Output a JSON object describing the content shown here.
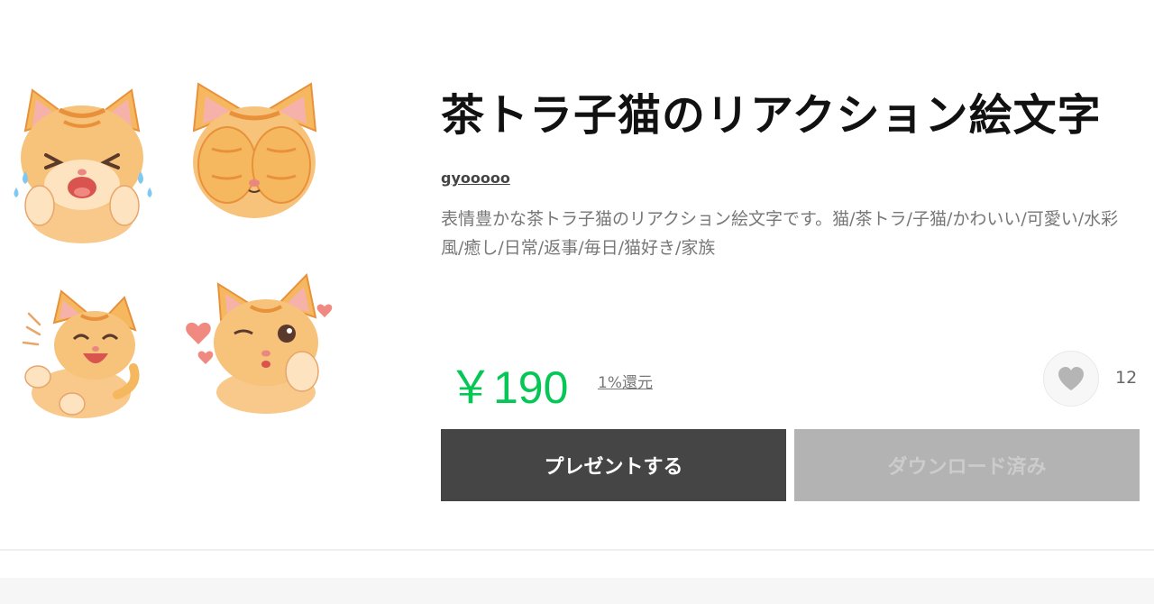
{
  "product": {
    "title": "茶トラ子猫のリアクション絵文字",
    "author": "gyooooo",
    "description": "表情豊かな茶トラ子猫のリアクション絵文字です。猫/茶トラ/子猫/かわいい/可愛い/水彩風/癒し/日常/返事/毎日/猫好き/家族",
    "price": "￥190",
    "cashback": "1%還元",
    "favorites_count": "12"
  },
  "buttons": {
    "present_label": "プレゼントする",
    "download_label": "ダウンロード済み"
  },
  "stickers": [
    {
      "name": "crying-kitten"
    },
    {
      "name": "covering-eyes-kitten"
    },
    {
      "name": "laughing-kitten"
    },
    {
      "name": "winking-kitten"
    }
  ],
  "icons": {
    "favorite": "heart-icon"
  },
  "colors": {
    "price": "#06c755",
    "present_button": "#454545",
    "download_button": "#b3b3b3",
    "kitten_fur": "#f5b85f",
    "kitten_stripes": "#e8913a"
  }
}
